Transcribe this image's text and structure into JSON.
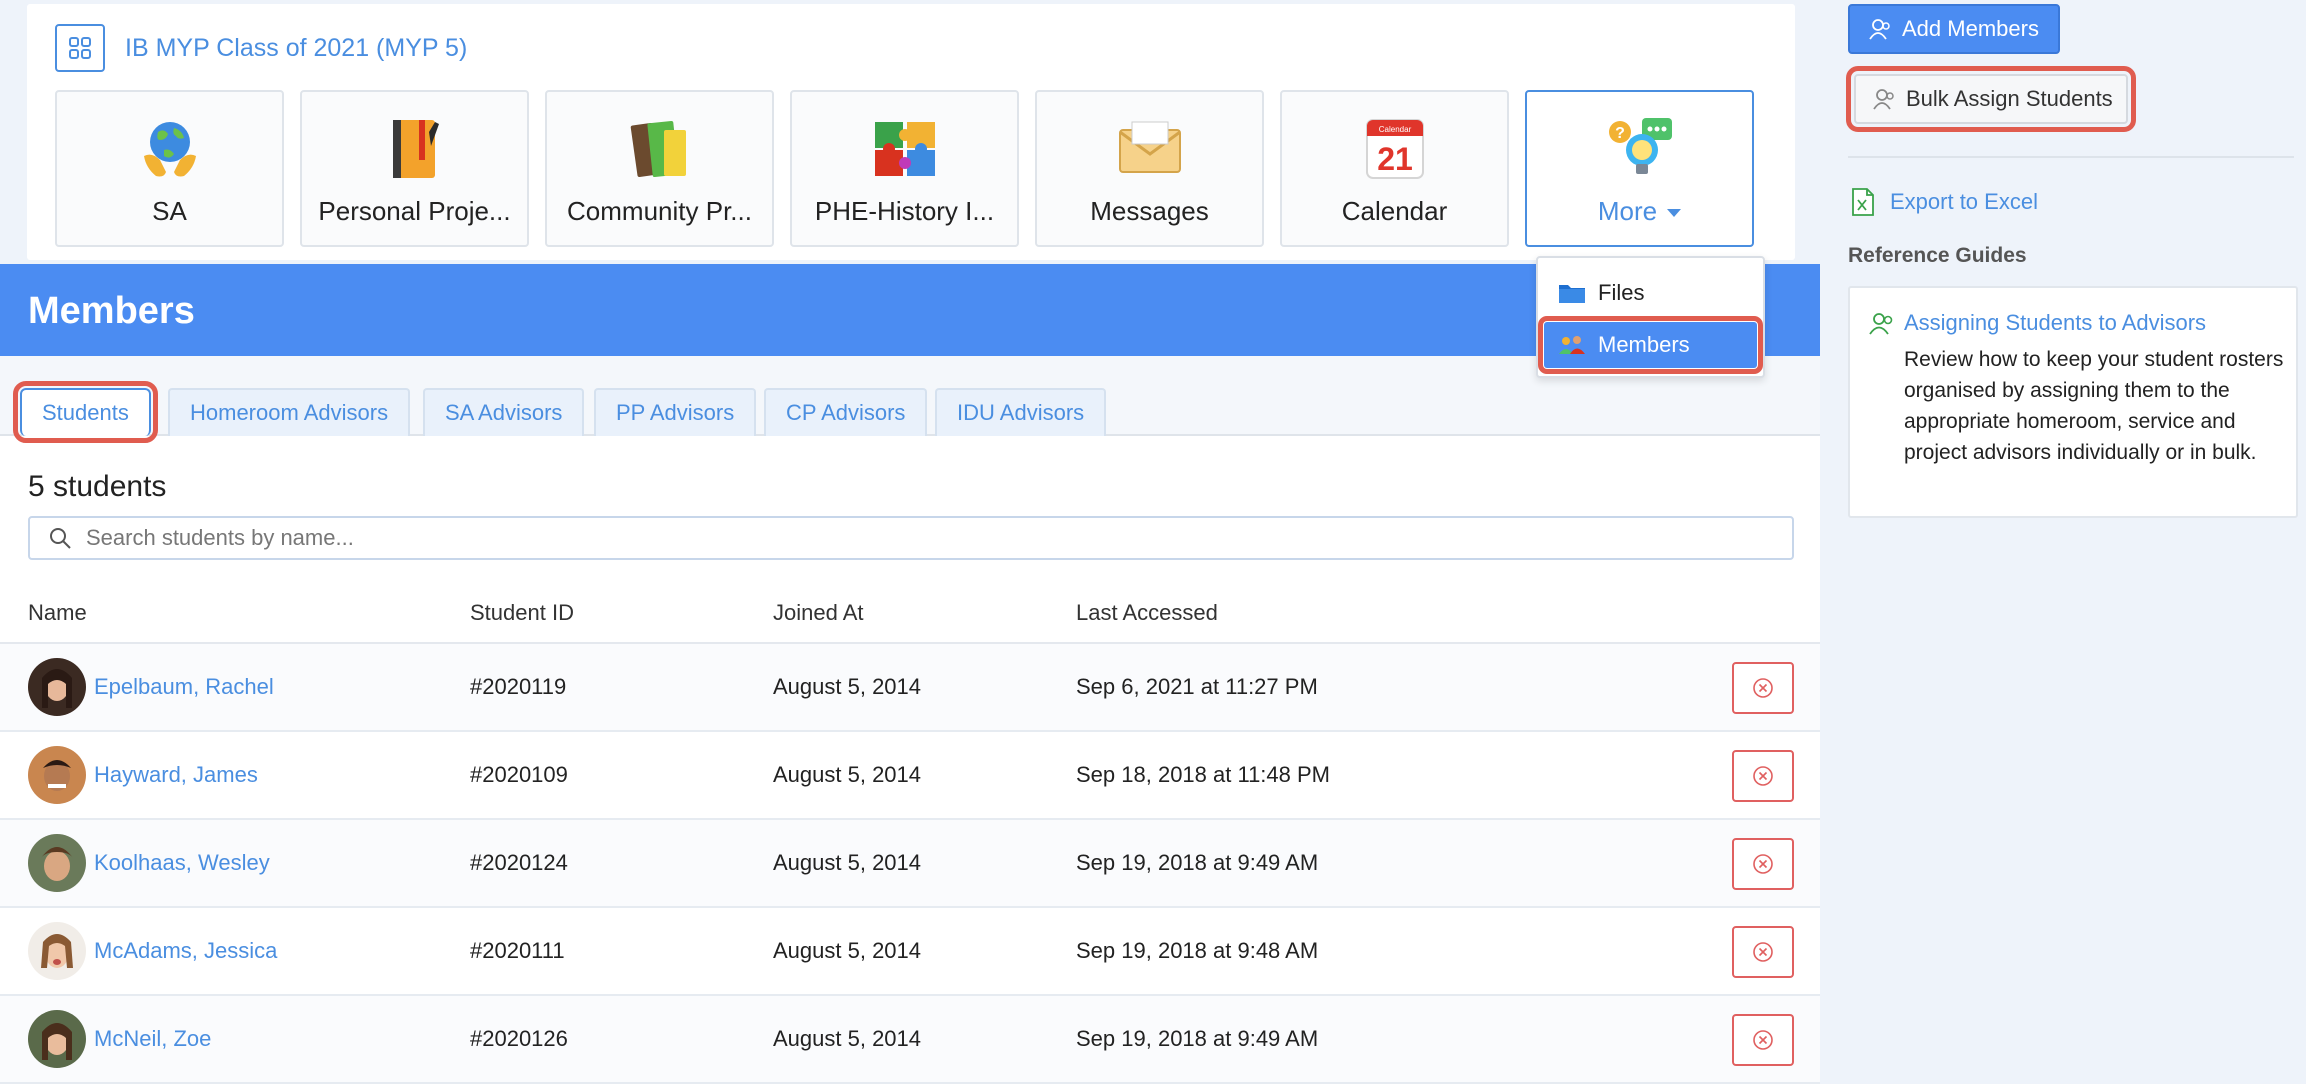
{
  "group": {
    "title": "IB MYP Class of 2021 (MYP 5)"
  },
  "tools": [
    {
      "label": "SA",
      "icon": "globe-hands-icon"
    },
    {
      "label": "Personal Proje...",
      "icon": "notebook-icon"
    },
    {
      "label": "Community Pr...",
      "icon": "books-icon"
    },
    {
      "label": "PHE-History I...",
      "icon": "puzzle-icon"
    },
    {
      "label": "Messages",
      "icon": "envelope-icon"
    },
    {
      "label": "Calendar",
      "icon": "calendar-icon",
      "calendar_header": "Calendar",
      "calendar_day": "21"
    },
    {
      "label": "More",
      "icon": "lightbulb-chat-icon"
    }
  ],
  "more_menu": {
    "items": [
      {
        "label": "Files",
        "icon": "folder-icon"
      },
      {
        "label": "Members",
        "icon": "people-icon"
      }
    ]
  },
  "page": {
    "title": "Members"
  },
  "tabs": [
    {
      "label": "Students"
    },
    {
      "label": "Homeroom Advisors"
    },
    {
      "label": "SA Advisors"
    },
    {
      "label": "PP Advisors"
    },
    {
      "label": "CP Advisors"
    },
    {
      "label": "IDU Advisors"
    }
  ],
  "students": {
    "count_label": "5 students",
    "search_placeholder": "Search students by name...",
    "columns": {
      "name": "Name",
      "student_id": "Student ID",
      "joined_at": "Joined At",
      "last_accessed": "Last Accessed"
    },
    "rows": [
      {
        "name": "Epelbaum, Rachel",
        "student_id": "#2020119",
        "joined_at": "August 5, 2014",
        "last_accessed": "Sep 6, 2021 at 11:27 PM"
      },
      {
        "name": "Hayward, James",
        "student_id": "#2020109",
        "joined_at": "August 5, 2014",
        "last_accessed": "Sep 18, 2018 at 11:48 PM"
      },
      {
        "name": "Koolhaas, Wesley",
        "student_id": "#2020124",
        "joined_at": "August 5, 2014",
        "last_accessed": "Sep 19, 2018 at 9:49 AM"
      },
      {
        "name": "McAdams, Jessica",
        "student_id": "#2020111",
        "joined_at": "August 5, 2014",
        "last_accessed": "Sep 19, 2018 at 9:48 AM"
      },
      {
        "name": "McNeil, Zoe",
        "student_id": "#2020126",
        "joined_at": "August 5, 2014",
        "last_accessed": "Sep 19, 2018 at 9:49 AM"
      }
    ]
  },
  "sidebar": {
    "add_members": "Add Members",
    "bulk_assign": "Bulk Assign Students",
    "export": "Export to Excel",
    "reference_title": "Reference Guides",
    "guide": {
      "title": "Assigning Students to Advisors",
      "description": "Review how to keep your student rosters organised by assigning them to the appropriate homeroom, service and project advisors individually or in bulk."
    }
  },
  "colors": {
    "accent": "#4b8cf2",
    "link": "#4a8ee0",
    "highlight": "#e05c4f",
    "remove": "#e06060"
  }
}
